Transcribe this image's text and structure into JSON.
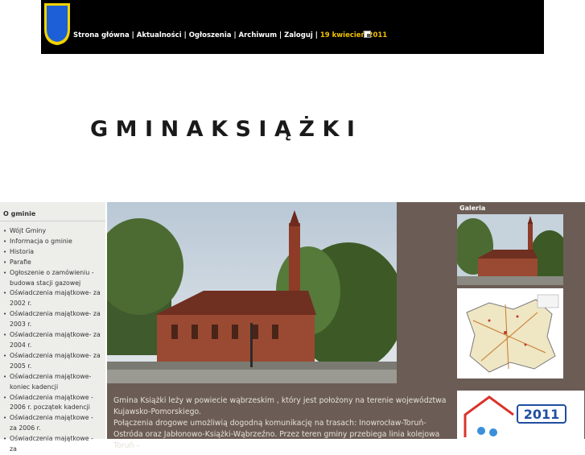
{
  "header": {
    "nav": [
      "Strona główna",
      "Aktualności",
      "Ogłoszenia",
      "Archiwum",
      "Zaloguj"
    ],
    "separator": "|",
    "date": "19 kwiecień 2011"
  },
  "site": {
    "title": "GMINAKSIĄŻKI"
  },
  "sidebar": {
    "heading": "O gminie",
    "items": [
      "Wójt Gminy",
      "Informacja o gminie",
      "Historia",
      "Parafie",
      "Ogłoszenie o zamówieniu - budowa stacji gazowej",
      "Oświadczenia majątkowe- za 2002 r.",
      "Oświadczenia majątkowe- za 2003 r.",
      "Oświadczenia majątkowe- za 2004 r.",
      "Oświadczenia majątkowe- za 2005 r.",
      "Oświadczenia majątkowe- koniec kadencji",
      "Oświadczenia majątkowe - 2006 r. początek kadencji",
      "Oświadczenia majątkowe - za 2006 r.",
      "Oświadczenia majątkowe - za"
    ]
  },
  "main": {
    "paragraph1": "Gmina Książki leży w powiecie wąbrzeskim , który jest położony na terenie województwa Kujawsko-Pomorskiego.",
    "paragraph2": "Połączenia drogowe umożliwią dogodną komunikację na trasach: Inowrocław-Toruń-Ostróda oraz Jabłonowo-Książki-Wąbrzeźno. Przez teren gminy przebiega linia kolejowa Toruń –"
  },
  "gallery": {
    "heading": "Galeria",
    "banner_year": "2011"
  },
  "colors": {
    "topbar": "#000000",
    "accent_date": "#f2c200",
    "content_bg": "#6b5d55",
    "sidebar_bg": "#ededea"
  }
}
